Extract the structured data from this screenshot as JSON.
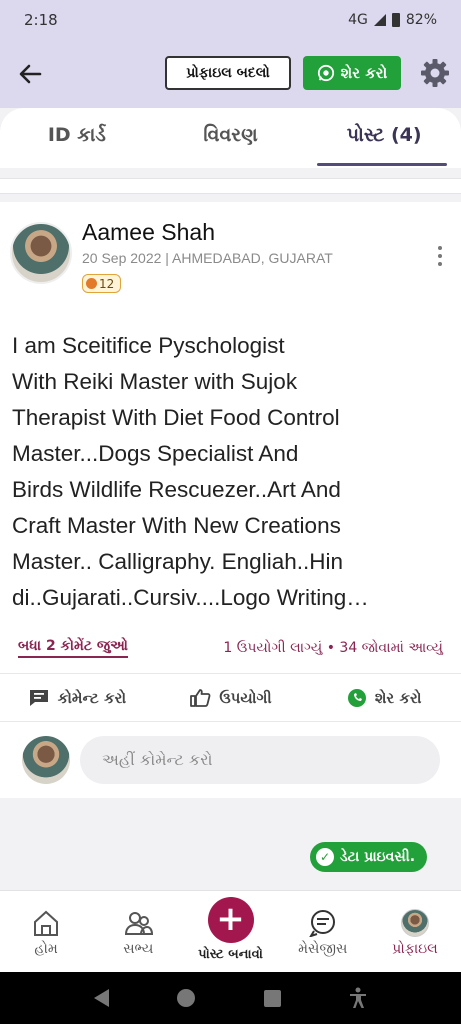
{
  "status_bar": {
    "time": "2:18",
    "network": "4G",
    "battery": "82%"
  },
  "header": {
    "edit_profile_label": "પ્રોફાઇલ બદલો",
    "share_label": "શેર કરો"
  },
  "tabs": [
    {
      "label": "ID કાર્ડ",
      "active": false
    },
    {
      "label": "વિવરણ",
      "active": false
    },
    {
      "label": "પોસ્ટ (4)",
      "active": true
    }
  ],
  "post": {
    "author": "Aamee Shah",
    "meta": "20 Sep 2022 | AHMEDABAD, GUJARAT",
    "badge_count": "12",
    "text": "I am Sceitifice Pyschologist\nWith Reiki Master with Sujok\nTherapist With Diet Food Control\nMaster...Dogs Specialist And\nBirds Wildlife Rescuezer..Art And\nCraft Master With New Creations\nMaster.. Calligraphy. Engliah..Hin\ndi..Gujarati..Cursiv....Logo Writing…",
    "view_comments": "બધા 2 કોમેંટ જુઓ",
    "stats": "1 ઉપયોગી લાગ્યું • 34 જોવામાં આવ્યું",
    "actions": {
      "comment": "કોમેન્ટ કરો",
      "useful": "ઉપયોગી",
      "share": "શેર કરો"
    },
    "comment_placeholder": "અહીં કોમેન્ટ કરો"
  },
  "privacy_chip": "ડેટા પ્રાઇવસી.",
  "bottom_nav": [
    {
      "label": "હોમ",
      "icon": "home-icon"
    },
    {
      "label": "સભ્ય",
      "icon": "members-icon"
    },
    {
      "label": "પોસ્ટ બનાવો",
      "icon": "plus-icon"
    },
    {
      "label": "મેસેજીસ",
      "icon": "chat-icon"
    },
    {
      "label": "પ્રોફાઇલ",
      "icon": "avatar",
      "active": true
    }
  ],
  "colors": {
    "accent": "#8a2451",
    "header_bg": "#dcd8ee",
    "green": "#22a03a",
    "plus": "#a3174f"
  }
}
